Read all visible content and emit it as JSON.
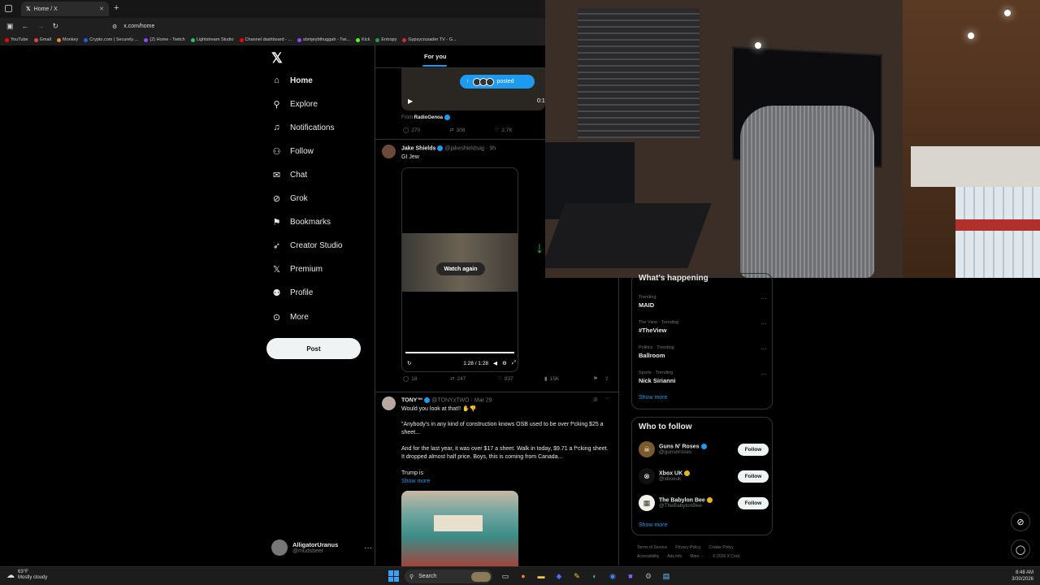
{
  "browser": {
    "tab_title": "Home / X",
    "url": "x.com/home",
    "bookmarks": [
      {
        "label": "YouTube",
        "color": "#ff0000"
      },
      {
        "label": "Gmail",
        "color": "#ea4335"
      },
      {
        "label": "Monkey",
        "color": "#e88a2e"
      },
      {
        "label": "Crypto.com | Securely ...",
        "color": "#2a5ada"
      },
      {
        "label": "(2) Home - Twitch",
        "color": "#9146ff"
      },
      {
        "label": "Lightstream Studio",
        "color": "#22c55e"
      },
      {
        "label": "Channel dashboard - ...",
        "color": "#ff0000"
      },
      {
        "label": "sbmjeybthuggah - Twi...",
        "color": "#9146ff"
      },
      {
        "label": "Kick",
        "color": "#53fc18"
      },
      {
        "label": "Entropy",
        "color": "#16a34a"
      },
      {
        "label": "Gypsycrusader TV - G...",
        "color": "#dc2626"
      }
    ]
  },
  "nav": {
    "items": [
      {
        "label": "Home",
        "icon": "home-icon",
        "glyph": "⌂"
      },
      {
        "label": "Explore",
        "icon": "search-icon",
        "glyph": "⚲"
      },
      {
        "label": "Notifications",
        "icon": "bell-icon",
        "glyph": "♫"
      },
      {
        "label": "Follow",
        "icon": "person-plus-icon",
        "glyph": "⚇"
      },
      {
        "label": "Chat",
        "icon": "mail-icon",
        "glyph": "✉"
      },
      {
        "label": "Grok",
        "icon": "grok-icon",
        "glyph": "⊘"
      },
      {
        "label": "Bookmarks",
        "icon": "bookmark-icon",
        "glyph": "⚑"
      },
      {
        "label": "Creator Studio",
        "icon": "rocket-icon",
        "glyph": "➶"
      },
      {
        "label": "Premium",
        "icon": "x-premium-icon",
        "glyph": "𝕏"
      },
      {
        "label": "Profile",
        "icon": "profile-icon",
        "glyph": "⚉"
      },
      {
        "label": "More",
        "icon": "more-circle-icon",
        "glyph": "⊙"
      }
    ],
    "post_label": "Post",
    "account_name": "AlligatorUranus",
    "account_handle": "@mudsbeer"
  },
  "feed": {
    "tab": "For you",
    "post1": {
      "pill_label": "posted",
      "video_time": "0:1",
      "from_label": "From",
      "from_name": "RadioGenoa",
      "replies": "270",
      "reposts": "308",
      "likes": "2.7K"
    },
    "post2": {
      "name": "Jake Shields",
      "handle": "@jakeshieldsajj · 9h",
      "text": "GI Jew",
      "watch_again": "Watch again",
      "video_time": "1:28 / 1:28",
      "replies": "18",
      "reposts": "247",
      "likes": "937",
      "views": "15K"
    },
    "post3": {
      "name": "TONY™",
      "handle": "@TONYxTWO · Mar 29",
      "line1": "Would you look at that!! ✋👎",
      "line2": "\"Anybody's in any kind of construction knows OSB used to be over f*cking $25 a sheet...",
      "line3": "And for the last year, it was over $17 a sheet. Walk in today, $9.71 a f*cking sheet. It dropped almost half price. Boys, this is coming from Canada...",
      "line4": "Trump is",
      "show_more": "Show more"
    }
  },
  "right": {
    "whats_happening": "What's happening",
    "trends": [
      {
        "meta": "Trending",
        "name": "MAID"
      },
      {
        "meta": "The View · Trending",
        "name": "#TheView"
      },
      {
        "meta": "Politics · Trending",
        "name": "Ballroom"
      },
      {
        "meta": "Sports · Trending",
        "name": "Nick Sirianni"
      }
    ],
    "show_more": "Show more",
    "who_to_follow": "Who to follow",
    "follows": [
      {
        "name": "Guns N' Roses",
        "handle": "@gunsnroses",
        "button": "Follow"
      },
      {
        "name": "Xbox UK",
        "handle": "@xboxuk",
        "button": "Follow"
      },
      {
        "name": "The Babylon Bee",
        "handle": "@TheBabylonBee",
        "button": "Follow"
      }
    ],
    "follow_show_more": "Show more",
    "footer1": [
      "Terms of Service",
      "Privacy Policy",
      "Cookie Policy"
    ],
    "footer2": [
      "Accessibility",
      "Ads info",
      "More ···",
      "© 2026 X Corp."
    ]
  },
  "taskbar": {
    "temp": "63°F",
    "weather": "Mostly cloudy",
    "search": "Search",
    "time": "8:48 AM",
    "date": "3/30/2026"
  }
}
